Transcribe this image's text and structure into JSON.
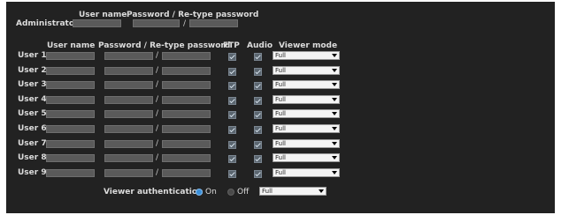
{
  "admin": {
    "label": "Administrator",
    "username_header": "User name",
    "password_header": "Password / Re-type password",
    "slash": "/"
  },
  "users_header": {
    "username": "User name",
    "password": "Password / Re-type password",
    "ftp": "FTP",
    "audio": "Audio",
    "viewer_mode": "Viewer mode"
  },
  "users": [
    {
      "label": "User 1",
      "slash": "/",
      "ftp": true,
      "audio": true,
      "mode": "Full"
    },
    {
      "label": "User 2",
      "slash": "/",
      "ftp": true,
      "audio": true,
      "mode": "Full"
    },
    {
      "label": "User 3",
      "slash": "/",
      "ftp": true,
      "audio": true,
      "mode": "Full"
    },
    {
      "label": "User 4",
      "slash": "/",
      "ftp": true,
      "audio": true,
      "mode": "Full"
    },
    {
      "label": "User 5",
      "slash": "/",
      "ftp": true,
      "audio": true,
      "mode": "Full"
    },
    {
      "label": "User 6",
      "slash": "/",
      "ftp": true,
      "audio": true,
      "mode": "Full"
    },
    {
      "label": "User 7",
      "slash": "/",
      "ftp": true,
      "audio": true,
      "mode": "Full"
    },
    {
      "label": "User 8",
      "slash": "/",
      "ftp": true,
      "audio": true,
      "mode": "Full"
    },
    {
      "label": "User 9",
      "slash": "/",
      "ftp": true,
      "audio": true,
      "mode": "Full"
    }
  ],
  "viewer_auth": {
    "label": "Viewer authentication",
    "on_label": "On",
    "off_label": "Off",
    "selected": "On",
    "mode": "Full"
  },
  "colors": {
    "panel_bg": "#222222",
    "field_bg": "#5a5a5a",
    "radio_on": "#3a8fd8"
  }
}
